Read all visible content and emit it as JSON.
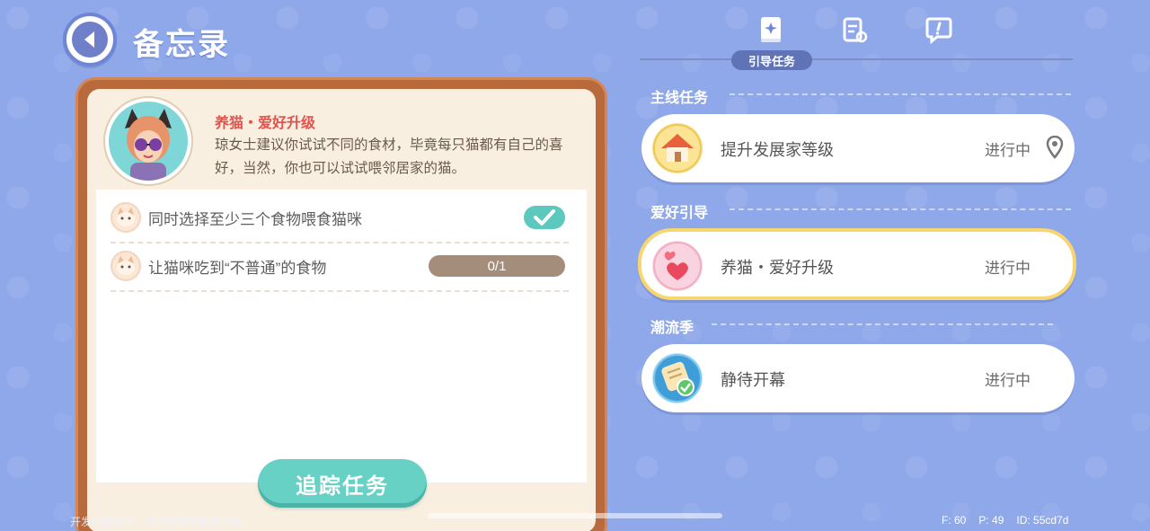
{
  "header": {
    "title": "备忘录"
  },
  "npc": {
    "task_title": "养猫・爱好升级",
    "description": "琼女士建议你试试不同的食材，毕竟每只猫都有自己的喜好，当然，你也可以试试喂邻居家的猫。"
  },
  "tasks": [
    {
      "text": "同时选择至少三个食物喂食猫咪",
      "status": "done"
    },
    {
      "text": "让猫咪吃到“不普通”的食物",
      "progress": "0/1"
    }
  ],
  "track_button": "追踪任务",
  "tabs": {
    "active_label": "引导任务",
    "icons": [
      "guide-book-icon",
      "clipboard-icon",
      "chat-alert-icon"
    ]
  },
  "sections": [
    {
      "label": "主线任务",
      "quests": [
        {
          "name": "提升发展家等级",
          "status": "进行中",
          "icon": "house-icon",
          "pinned": true
        }
      ]
    },
    {
      "label": "爱好引导",
      "quests": [
        {
          "name": "养猫・爱好升级",
          "status": "进行中",
          "icon": "hearts-icon",
          "selected": true
        }
      ]
    },
    {
      "label": "潮流季",
      "quests": [
        {
          "name": "静待开幕",
          "status": "进行中",
          "icon": "scroll-check-icon"
        }
      ]
    }
  ],
  "footer": {
    "note": "开发测试版本，不代表游戏最终品质",
    "fps": "F: 60",
    "ping": "P: 49",
    "id": "ID: 55cd7d"
  },
  "colors": {
    "background": "#8fa8ea",
    "accent_teal": "#66d1c4",
    "highlight": "#f7d66f",
    "task_title_red": "#e4534b"
  }
}
